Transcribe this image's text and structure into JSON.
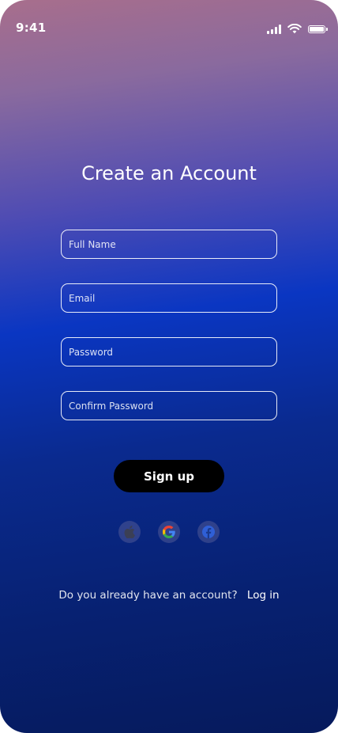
{
  "status_bar": {
    "time": "9:41"
  },
  "title": "Create an Account",
  "fields": {
    "full_name": {
      "placeholder": "Full Name",
      "value": ""
    },
    "email": {
      "placeholder": "Email",
      "value": ""
    },
    "password": {
      "placeholder": "Password",
      "value": ""
    },
    "confirm_password": {
      "placeholder": "Confirm Password",
      "value": ""
    }
  },
  "signup_button": "Sign up",
  "social_icons": [
    "apple-icon",
    "google-icon",
    "facebook-icon"
  ],
  "login_prompt": {
    "question": "Do you already have an account?",
    "link": "Log in"
  },
  "colors": {
    "gradient_top": "#a86e8c",
    "gradient_mid": "#0a36c2",
    "gradient_bottom": "#061a5c",
    "button_bg": "#000000",
    "text": "#ffffff"
  }
}
